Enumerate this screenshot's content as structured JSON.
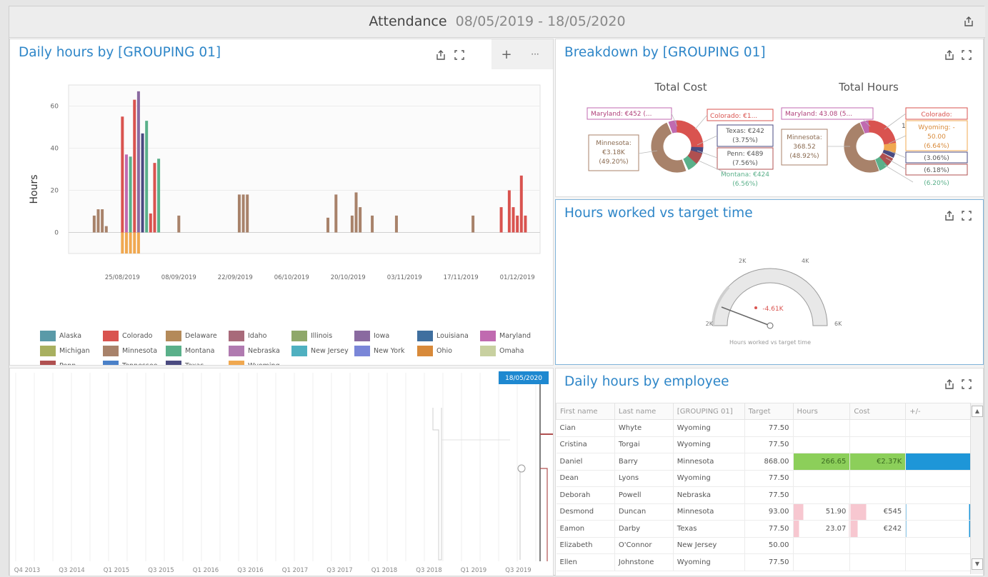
{
  "header": {
    "title": "Attendance",
    "range": "08/05/2019 - 18/05/2020"
  },
  "daily_hours_panel": {
    "title": "Daily hours by [GROUPING 01]",
    "add_symbol": "+",
    "more_symbol": "···"
  },
  "breakdown_panel": {
    "title": "Breakdown by [GROUPING 01]",
    "cost_title": "Total Cost",
    "hours_title": "Total Hours",
    "cost_labels": {
      "maryland": "Maryland: €452 (...",
      "colorado": "Colorado: €1...",
      "texas": "Texas: €242",
      "texas_pct": "(3.75%)",
      "penn": "Penn: €489",
      "penn_pct": "(7.56%)",
      "montana": "Montana: €424",
      "montana_pct": "(6.56%)",
      "minnesota_line1": "Minnesota:",
      "minnesota_line2": "€3.18K",
      "minnesota_line3": "(49.20%)"
    },
    "hours_labels": {
      "maryland": "Maryland: 43.08 (5...",
      "colorado": "Colorado:",
      "wyoming_line1": "Wyoming: -",
      "wyoming_line2": "50.00",
      "wyoming_line3": "(6.64%)",
      "pct_a": "(3.06%)",
      "pct_b": "(6.18%)",
      "pct_c": "(6.20%)",
      "one": "1",
      "minnesota_line1": "Minnesota:",
      "minnesota_line2": "368.52",
      "minnesota_line3": "(48.92%)"
    }
  },
  "gauge_panel": {
    "title": "Hours worked vs target time",
    "tick_left": "2K",
    "tick_2k": "2K",
    "tick_4k": "4K",
    "tick_right": "6K",
    "value": "-4.61K",
    "caption": "Hours worked vs target time",
    "pointer_value": -4610
  },
  "timeline_panel": {
    "selected_date": "18/05/2020",
    "ticks": [
      "Q4 2013",
      "Q3 2014",
      "Q1 2015",
      "Q3 2015",
      "Q1 2016",
      "Q3 2016",
      "Q1 2017",
      "Q3 2017",
      "Q1 2018",
      "Q3 2018",
      "Q1 2019",
      "Q3 2019"
    ]
  },
  "employee_panel": {
    "title": "Daily hours by employee",
    "columns": [
      "First name",
      "Last name",
      "[GROUPING 01]",
      "Target",
      "Hours",
      "Cost",
      "+/-"
    ],
    "rows": [
      {
        "first": "Cian",
        "last": "Whyte",
        "group": "Wyoming",
        "target": "77.50",
        "hours": "",
        "cost": "",
        "diff": ""
      },
      {
        "first": "Cristina",
        "last": "Torgai",
        "group": "Wyoming",
        "target": "77.50",
        "hours": "",
        "cost": "",
        "diff": ""
      },
      {
        "first": "Daniel",
        "last": "Barry",
        "group": "Minnesota",
        "target": "868.00",
        "hours": "266.65",
        "cost": "€2.37K",
        "diff": ""
      },
      {
        "first": "Dean",
        "last": "Lyons",
        "group": "Wyoming",
        "target": "77.50",
        "hours": "",
        "cost": "",
        "diff": ""
      },
      {
        "first": "Deborah",
        "last": "Powell",
        "group": "Nebraska",
        "target": "77.50",
        "hours": "",
        "cost": "",
        "diff": ""
      },
      {
        "first": "Desmond",
        "last": "Duncan",
        "group": "Minnesota",
        "target": "93.00",
        "hours": "51.90",
        "cost": "€545",
        "diff": ""
      },
      {
        "first": "Eamon",
        "last": "Darby",
        "group": "Texas",
        "target": "77.50",
        "hours": "23.07",
        "cost": "€242",
        "diff": ""
      },
      {
        "first": "Elizabeth",
        "last": "O'Connor",
        "group": "New Jersey",
        "target": "50.00",
        "hours": "",
        "cost": "",
        "diff": ""
      },
      {
        "first": "Ellen",
        "last": "Johnstone",
        "group": "Wyoming",
        "target": "77.50",
        "hours": "",
        "cost": "",
        "diff": ""
      }
    ]
  },
  "chart_data": {
    "type": "bar",
    "title": "",
    "ylabel": "Hours",
    "xlabel": "",
    "ylim": [
      -10,
      70
    ],
    "yticks": [
      0,
      20,
      40,
      60
    ],
    "xtick_labels": [
      "25/08/2019",
      "08/09/2019",
      "22/09/2019",
      "06/10/2019",
      "20/10/2019",
      "03/11/2019",
      "17/11/2019",
      "01/12/2019"
    ],
    "legend": [
      "Alaska",
      "Colorado",
      "Delaware",
      "Idaho",
      "Illinois",
      "Iowa",
      "Louisiana",
      "Maryland",
      "Michigan",
      "Minnesota",
      "Montana",
      "Nebraska",
      "New Jersey",
      "New York",
      "Ohio",
      "Omaha",
      "Penn",
      "Tennessee",
      "Texas",
      "Wyoming"
    ],
    "legend_colors": [
      "#5a9aa8",
      "#d9534f",
      "#b48a5a",
      "#a86a7a",
      "#8fa86a",
      "#8a6aa0",
      "#3f6f9f",
      "#c06ab0",
      "#a8b060",
      "#a8826a",
      "#5ab08a",
      "#b07ab0",
      "#4fb0c0",
      "#7a86d8",
      "#d88a3a",
      "#c8d0a0",
      "#b05050",
      "#4a80c8",
      "#4a4a80",
      "#f0a850"
    ],
    "bars": [
      {
        "date": "2019-08-18",
        "value": 8,
        "color": "#a8826a"
      },
      {
        "date": "2019-08-19",
        "value": 11,
        "color": "#a8826a"
      },
      {
        "date": "2019-08-20",
        "value": 11,
        "color": "#a8826a"
      },
      {
        "date": "2019-08-21",
        "value": 3,
        "color": "#a8826a"
      },
      {
        "date": "2019-08-25",
        "value": 55,
        "color": "#d9534f",
        "neg": -10
      },
      {
        "date": "2019-08-26",
        "value": 37,
        "color": "#c06ab0",
        "neg": -10
      },
      {
        "date": "2019-08-27",
        "value": 36,
        "color": "#5ab08a",
        "neg": -10
      },
      {
        "date": "2019-08-28",
        "value": 63,
        "color": "#d9534f",
        "neg": -10
      },
      {
        "date": "2019-08-29",
        "value": 67,
        "color": "#8a6aa0",
        "neg": -10
      },
      {
        "date": "2019-08-30",
        "value": 47,
        "color": "#4a4a80"
      },
      {
        "date": "2019-08-31",
        "value": 53,
        "color": "#5ab08a"
      },
      {
        "date": "2019-09-01",
        "value": 9,
        "color": "#d9534f"
      },
      {
        "date": "2019-09-02",
        "value": 33,
        "color": "#d9534f"
      },
      {
        "date": "2019-09-03",
        "value": 35,
        "color": "#5ab08a"
      },
      {
        "date": "2019-09-08",
        "value": 8,
        "color": "#a8826a"
      },
      {
        "date": "2019-09-23",
        "value": 18,
        "color": "#a8826a"
      },
      {
        "date": "2019-09-24",
        "value": 18,
        "color": "#a8826a"
      },
      {
        "date": "2019-09-25",
        "value": 18,
        "color": "#a8826a"
      },
      {
        "date": "2019-10-15",
        "value": 7,
        "color": "#a8826a"
      },
      {
        "date": "2019-10-17",
        "value": 18,
        "color": "#a8826a"
      },
      {
        "date": "2019-10-21",
        "value": 8,
        "color": "#a8826a"
      },
      {
        "date": "2019-10-22",
        "value": 19,
        "color": "#a8826a"
      },
      {
        "date": "2019-10-23",
        "value": 12,
        "color": "#a8826a"
      },
      {
        "date": "2019-10-26",
        "value": 8,
        "color": "#a8826a"
      },
      {
        "date": "2019-11-01",
        "value": 8,
        "color": "#a8826a"
      },
      {
        "date": "2019-11-20",
        "value": 8,
        "color": "#a8826a"
      },
      {
        "date": "2019-11-27",
        "value": 12,
        "color": "#d9534f"
      },
      {
        "date": "2019-11-29",
        "value": 20,
        "color": "#d9534f"
      },
      {
        "date": "2019-11-30",
        "value": 12,
        "color": "#d9534f"
      },
      {
        "date": "2019-12-01",
        "value": 8,
        "color": "#d9534f"
      },
      {
        "date": "2019-12-02",
        "value": 27,
        "color": "#d9534f"
      },
      {
        "date": "2019-12-03",
        "value": 8,
        "color": "#d9534f"
      }
    ]
  }
}
